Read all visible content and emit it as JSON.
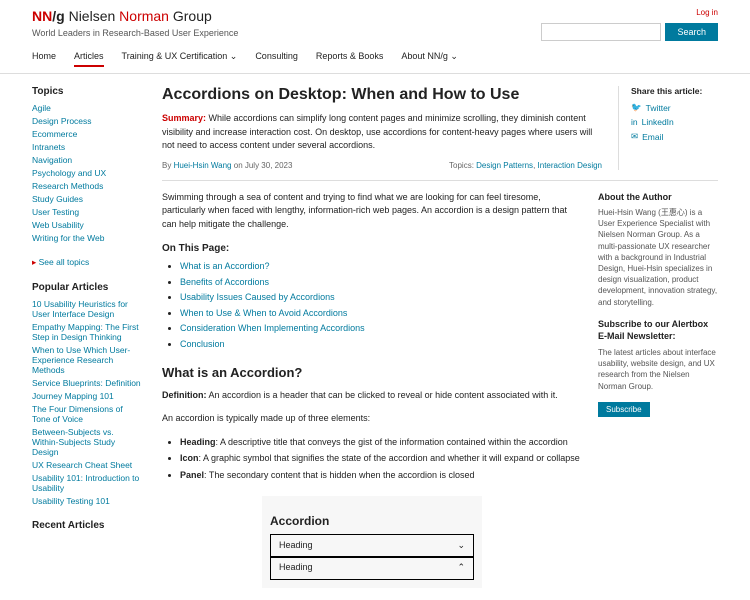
{
  "header": {
    "logo_nn": "NN",
    "logo_slash": "/g",
    "logo_nielsen": "Nielsen",
    "logo_norman": "Norman",
    "logo_group": "Group",
    "tagline": "World Leaders in Research-Based User Experience",
    "login": "Log in",
    "search_btn": "Search"
  },
  "nav": {
    "home": "Home",
    "articles": "Articles",
    "training": "Training & UX Certification",
    "consulting": "Consulting",
    "reports": "Reports & Books",
    "about": "About NN/g"
  },
  "sidebar": {
    "topics_h": "Topics",
    "topics": [
      "Agile",
      "Design Process",
      "Ecommerce",
      "Intranets",
      "Navigation",
      "Psychology and UX",
      "Research Methods",
      "Study Guides",
      "User Testing",
      "Web Usability",
      "Writing for the Web"
    ],
    "seeall": "See all topics",
    "popular_h": "Popular Articles",
    "popular": [
      "10 Usability Heuristics for User Interface Design",
      "Empathy Mapping: The First Step in Design Thinking",
      "When to Use Which User-Experience Research Methods",
      "Service Blueprints: Definition",
      "Journey Mapping 101",
      "The Four Dimensions of Tone of Voice",
      "Between-Subjects vs. Within-Subjects Study Design",
      "UX Research Cheat Sheet",
      "Usability 101: Introduction to Usability",
      "Usability Testing 101"
    ],
    "recent_h": "Recent Articles"
  },
  "article": {
    "title": "Accordions on Desktop: When and How to Use",
    "summary_label": "Summary:",
    "summary": " While accordions can simplify long content pages and minimize scrolling, they diminish content visibility and increase interaction cost. On desktop, use accordions for content-heavy pages where users will not need to access content under several accordions.",
    "by": "By ",
    "author": "Huei-Hsin Wang",
    "date": " on July 30, 2023",
    "topics_label": "Topics: ",
    "topic1": "Design Patterns",
    "topic2": "Interaction Design",
    "intro": "Swimming through a sea of content and trying to find what we are looking for can feel tiresome, particularly when faced with lengthy, information-rich web pages. An accordion is a design pattern that can help mitigate the challenge.",
    "on_page": "On This Page:",
    "toc": [
      "What is an Accordion?",
      "Benefits of Accordions",
      "Usability Issues Caused by Accordions",
      "When to Use & When to Avoid Accordions",
      "Consideration When Implementing Accordions",
      "Conclusion"
    ],
    "h2_1": "What is an Accordion?",
    "def_label": "Definition:",
    "def": " An accordion is a header that can be clicked to reveal or hide content associated with it.",
    "p2": "An accordion is typically made up of three elements:",
    "parts": [
      {
        "b": "Heading",
        "t": ": A descriptive title that conveys the gist of the information contained within the accordion"
      },
      {
        "b": "Icon",
        "t": ": A graphic symbol that signifies the state of the accordion and whether it will expand or collapse"
      },
      {
        "b": "Panel",
        "t": ": The secondary content that is hidden when the accordion is closed"
      }
    ],
    "demo_title": "Accordion",
    "demo_heading": "Heading"
  },
  "share": {
    "title": "Share this article:",
    "twitter": "Twitter",
    "linkedin": "LinkedIn",
    "email": "Email"
  },
  "right": {
    "about_h": "About the Author",
    "about": "Huei-Hsin Wang (王惠心) is a User Experience Specialist with Nielsen Norman Group. As a multi-passionate UX researcher with a background in Industrial Design, Huei-Hsin specializes in design visualization, product development, innovation strategy, and storytelling.",
    "sub_h": "Subscribe to our Alertbox E-Mail Newsletter:",
    "sub_p": "The latest articles about interface usability, website design, and UX research from the Nielsen Norman Group.",
    "sub_btn": "Subscribe"
  }
}
